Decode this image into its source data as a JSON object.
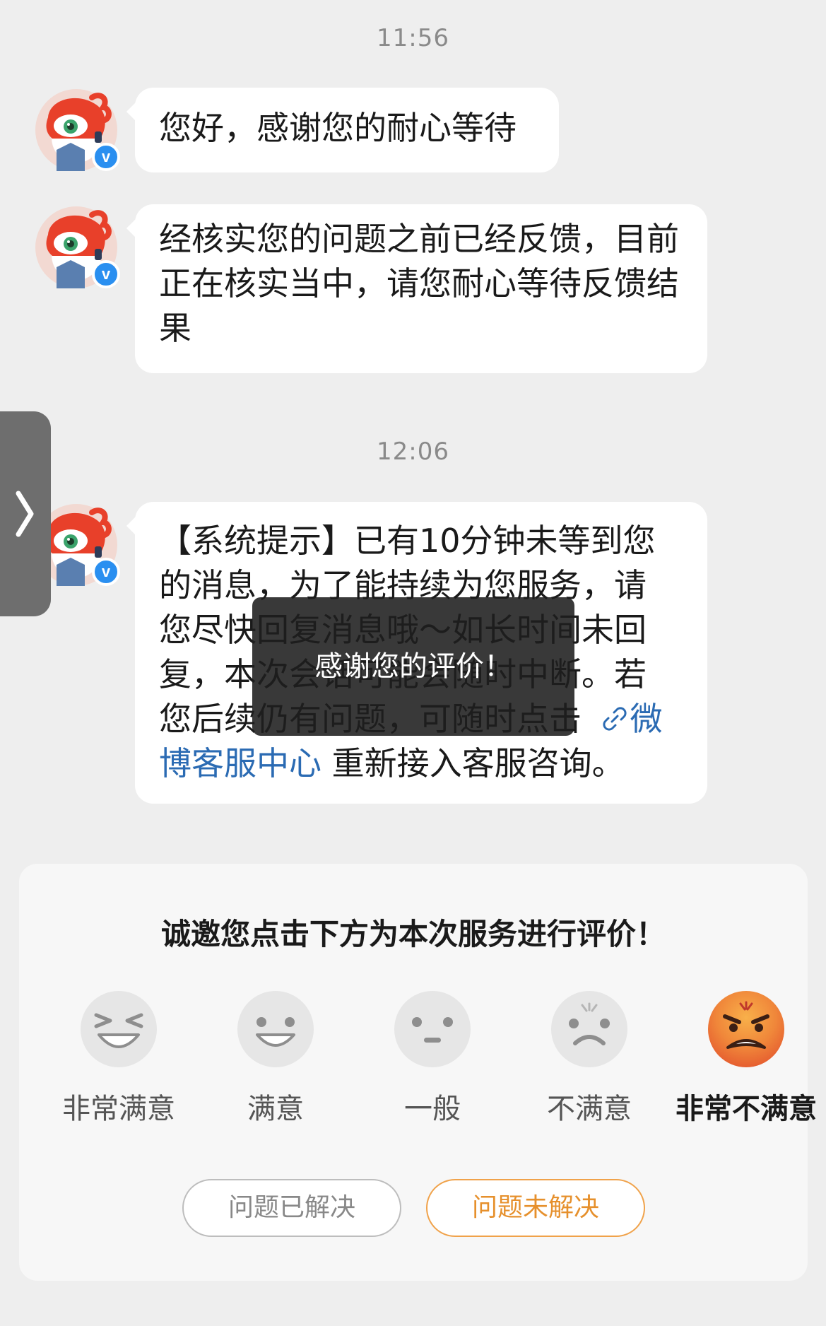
{
  "messages": [
    {
      "timestamp": "11:56",
      "text": "您好，感谢您的耐心等待"
    },
    {
      "text": "经核实您的问题之前已经反馈，目前正在核实当中，请您耐心等待反馈结果"
    },
    {
      "timestamp": "12:06",
      "lines": [
        "【系统提示】已有10分钟未等到您",
        "的消息，为了能持续为您服务，请",
        "您尽快回复消息哦～如长时间未回",
        "复，本次会话可能会随时中断。若",
        "您后续仍有问题，可随时点击"
      ],
      "link_label": "微",
      "link_label_2": "博客服中心",
      "tail": " 重新接入客服咨询。"
    }
  ],
  "avatar": {
    "badge": "v"
  },
  "toast": "感谢您的评价！",
  "rating": {
    "title": "诚邀您点击下方为本次服务进行评价！",
    "options": [
      {
        "label": "非常满意",
        "selected": false
      },
      {
        "label": "满意",
        "selected": false
      },
      {
        "label": "一般",
        "selected": false
      },
      {
        "label": "不满意",
        "selected": false
      },
      {
        "label": "非常不满意",
        "selected": true
      }
    ],
    "solved_label": "问题已解决",
    "unsolved_label": "问题未解决"
  },
  "colors": {
    "accent": "#e6902c",
    "link": "#2b6bb3",
    "badge": "#2a8ff0"
  }
}
